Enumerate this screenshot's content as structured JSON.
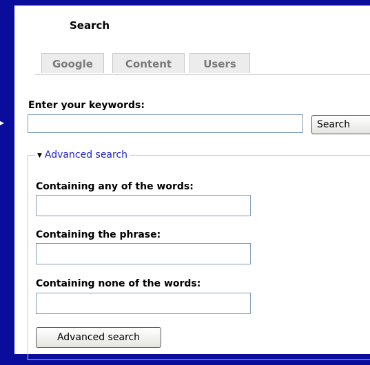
{
  "page": {
    "title": "Search"
  },
  "tabs": [
    {
      "label": "Google"
    },
    {
      "label": "Content"
    },
    {
      "label": "Users"
    }
  ],
  "keywords": {
    "label": "Enter your keywords:",
    "value": "",
    "button": "Search"
  },
  "advanced": {
    "legend": "Advanced search",
    "any_label": "Containing any of the words:",
    "any_value": "",
    "phrase_label": "Containing the phrase:",
    "phrase_value": "",
    "none_label": "Containing none of the words:",
    "none_value": "",
    "button": "Advanced search"
  },
  "icons": {
    "left_arrow": "▸",
    "collapse_triangle": "▼"
  },
  "colors": {
    "background": "#0a0c9c",
    "link": "#2020d0"
  }
}
